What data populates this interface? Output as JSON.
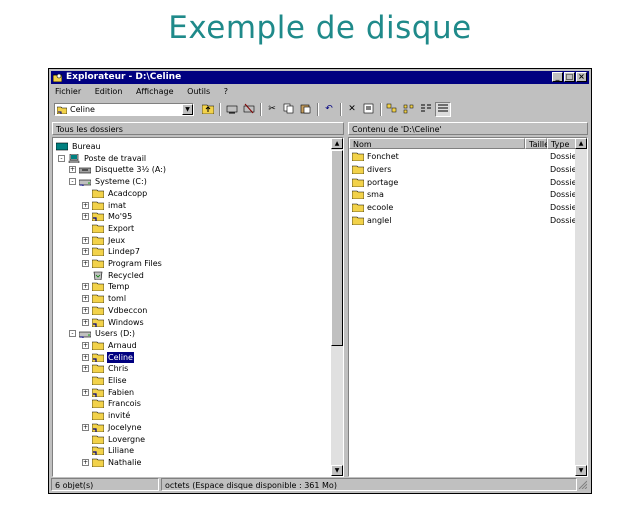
{
  "slide": {
    "title": "Exemple de disque"
  },
  "window": {
    "title": "Explorateur - D:\\Celine"
  },
  "menu": [
    "Fichier",
    "Edition",
    "Affichage",
    "Outils",
    "?"
  ],
  "address": {
    "value": "Celine"
  },
  "panes": {
    "tree_header": "Tous les dossiers",
    "list_header": "Contenu de 'D:\\Celine'"
  },
  "tree": [
    {
      "label": "Bureau",
      "icon": "desktop-icon",
      "level": 0,
      "toggle": ""
    },
    {
      "label": "Poste de travail",
      "icon": "computer-icon",
      "level": 1,
      "toggle": "-"
    },
    {
      "label": "Disquette 3½ (A:)",
      "icon": "floppy-icon",
      "level": 2,
      "toggle": "+"
    },
    {
      "label": "Systeme (C:)",
      "icon": "drive-icon",
      "level": 2,
      "toggle": "-"
    },
    {
      "label": "Acadcopp",
      "icon": "folder-icon",
      "level": 3,
      "toggle": ""
    },
    {
      "label": "imat",
      "icon": "folder-icon",
      "level": 3,
      "toggle": "+"
    },
    {
      "label": "Mo'95",
      "icon": "shared-folder-icon",
      "level": 3,
      "toggle": "+"
    },
    {
      "label": "Export",
      "icon": "folder-icon",
      "level": 3,
      "toggle": ""
    },
    {
      "label": "Jeux",
      "icon": "folder-icon",
      "level": 3,
      "toggle": "+"
    },
    {
      "label": "Lindep7",
      "icon": "folder-icon",
      "level": 3,
      "toggle": "+"
    },
    {
      "label": "Program Files",
      "icon": "folder-icon",
      "level": 3,
      "toggle": "+"
    },
    {
      "label": "Recycled",
      "icon": "recycle-bin-icon",
      "level": 3,
      "toggle": ""
    },
    {
      "label": "Temp",
      "icon": "folder-icon",
      "level": 3,
      "toggle": "+"
    },
    {
      "label": "toml",
      "icon": "folder-icon",
      "level": 3,
      "toggle": "+"
    },
    {
      "label": "Vdbeccon",
      "icon": "folder-icon",
      "level": 3,
      "toggle": "+"
    },
    {
      "label": "Windows",
      "icon": "shared-folder-icon",
      "level": 3,
      "toggle": "+"
    },
    {
      "label": "Users (D:)",
      "icon": "drive-icon",
      "level": 2,
      "toggle": "-"
    },
    {
      "label": "Arnaud",
      "icon": "folder-icon",
      "level": 3,
      "toggle": "+"
    },
    {
      "label": "Celine",
      "icon": "shared-folder-icon",
      "level": 3,
      "toggle": "+",
      "selected": true
    },
    {
      "label": "Chris",
      "icon": "folder-icon",
      "level": 3,
      "toggle": "+"
    },
    {
      "label": "Elise",
      "icon": "folder-icon",
      "level": 3,
      "toggle": ""
    },
    {
      "label": "Fabien",
      "icon": "shared-folder-icon",
      "level": 3,
      "toggle": "+"
    },
    {
      "label": "Francois",
      "icon": "folder-icon",
      "level": 3,
      "toggle": ""
    },
    {
      "label": "invité",
      "icon": "folder-icon",
      "level": 3,
      "toggle": ""
    },
    {
      "label": "Jocelyne",
      "icon": "shared-folder-icon",
      "level": 3,
      "toggle": "+"
    },
    {
      "label": "Lovergne",
      "icon": "folder-icon",
      "level": 3,
      "toggle": ""
    },
    {
      "label": "Liliane",
      "icon": "shared-folder-icon",
      "level": 3,
      "toggle": ""
    },
    {
      "label": "Nathalie",
      "icon": "folder-icon",
      "level": 3,
      "toggle": "+"
    }
  ],
  "list_columns": {
    "name": "Nom",
    "size": "Taille",
    "type": "Type"
  },
  "list_items": [
    {
      "name": "Fonchet",
      "type": "Dossier"
    },
    {
      "name": "divers",
      "type": "Dossier"
    },
    {
      "name": "portage",
      "type": "Dossier"
    },
    {
      "name": "sma",
      "type": "Dossier"
    },
    {
      "name": "ecoole",
      "type": "Dossier"
    },
    {
      "name": "anglel",
      "type": "Dossier"
    }
  ],
  "status": {
    "left": "6 objet(s)",
    "right": "octets (Espace disque disponible : 361 Mo)"
  },
  "colors": {
    "title_text": "#1f8a8a",
    "titlebar": "#000080",
    "folder": "#f2d24a",
    "selection": "#000080"
  }
}
